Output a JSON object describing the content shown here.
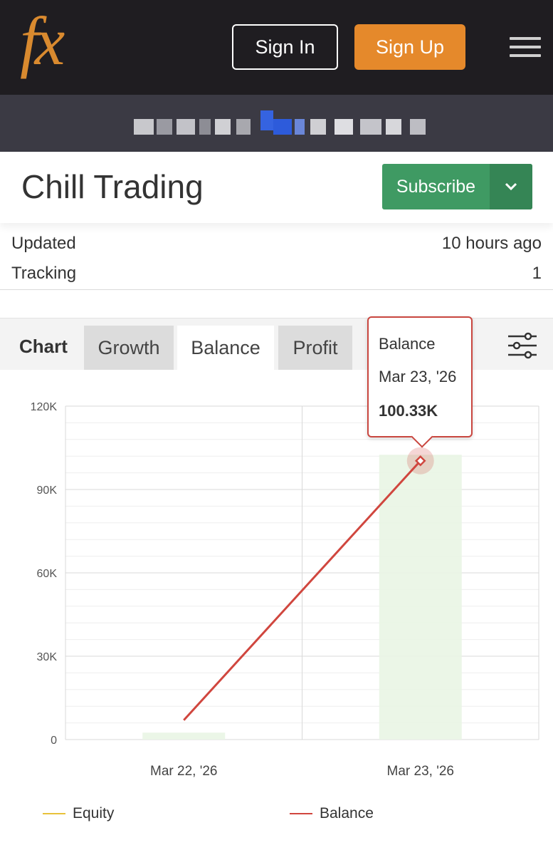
{
  "header": {
    "logo_text": "fx",
    "sign_in": "Sign In",
    "sign_up": "Sign Up",
    "accent": "#e5892b"
  },
  "system": {
    "title": "Chill Trading",
    "subscribe_label": "Subscribe",
    "info": [
      {
        "label": "Updated",
        "value": "10 hours ago"
      },
      {
        "label": "Tracking",
        "value": "1"
      }
    ]
  },
  "tabs": {
    "section": "Chart",
    "items": [
      "Growth",
      "Balance",
      "Profit"
    ],
    "active": "Balance"
  },
  "tooltip": {
    "series": "Balance",
    "date": "Mar 23, '26",
    "value": "100.33K"
  },
  "chart_data": {
    "type": "line",
    "categories": [
      "Mar 22, '26",
      "Mar 23, '26"
    ],
    "y_ticks": [
      "0",
      "30K",
      "60K",
      "90K",
      "120K"
    ],
    "ylim": [
      0,
      120000
    ],
    "series": [
      {
        "name": "Equity",
        "color": "#e8c23a",
        "values": [
          2500,
          102500
        ],
        "render": "column"
      },
      {
        "name": "Balance",
        "color": "#d0463e",
        "values": [
          7000,
          100330
        ],
        "render": "line"
      }
    ],
    "grid": true,
    "legend": "bottom"
  }
}
